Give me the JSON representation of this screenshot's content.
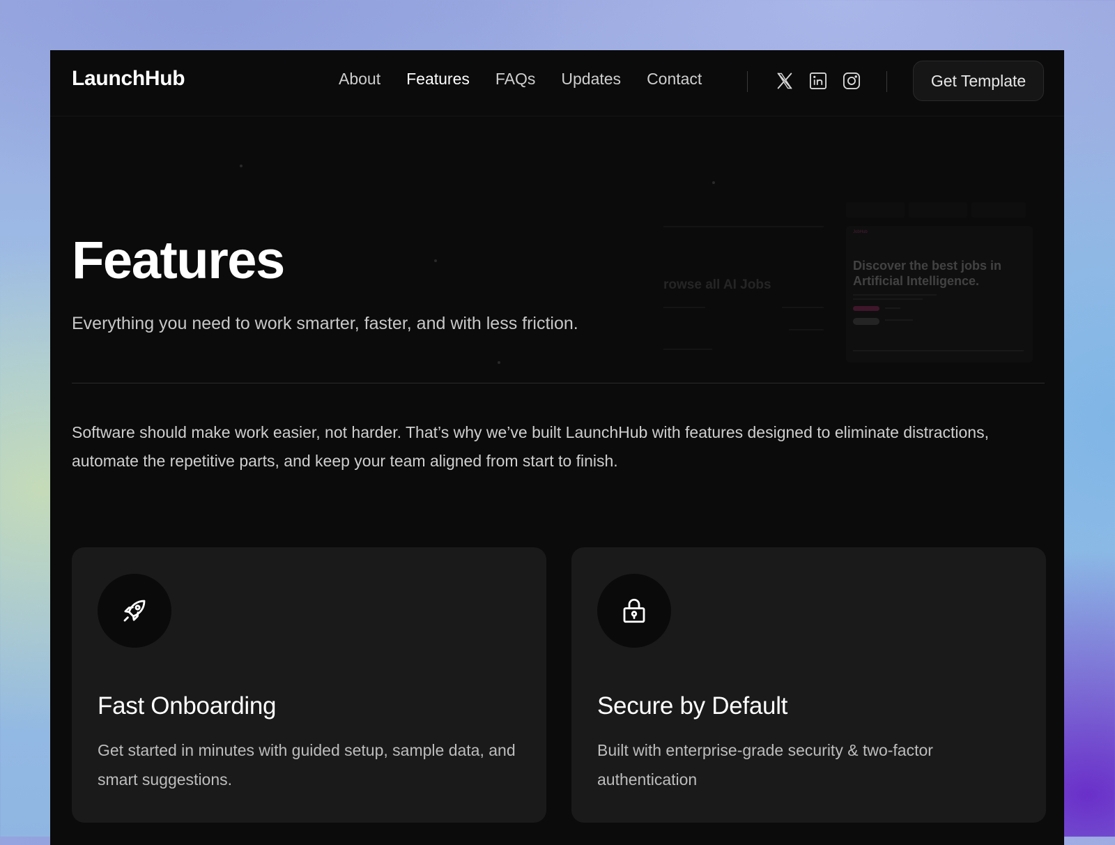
{
  "nav": {
    "logo": "LaunchHub",
    "links": [
      {
        "label": "About",
        "active": false
      },
      {
        "label": "Features",
        "active": true
      },
      {
        "label": "FAQs",
        "active": false
      },
      {
        "label": "Updates",
        "active": false
      },
      {
        "label": "Contact",
        "active": false
      }
    ],
    "social_icons": [
      "x-icon",
      "linkedin-icon",
      "instagram-icon"
    ],
    "cta_label": "Get Template"
  },
  "hero": {
    "title": "Features",
    "subtitle": "Everything you need to work smarter, faster, and with less friction."
  },
  "preview": {
    "left_title": "rowse all AI Jobs",
    "card_brand": "JobHub",
    "card_heading": "Discover the best jobs in Artificial Intelligence."
  },
  "intro": "Software should make work easier, not harder. That’s why we’ve built LaunchHub with features designed to eliminate distractions, automate the repetitive parts, and keep your team aligned from start to finish.",
  "features": [
    {
      "icon": "rocket-icon",
      "title": "Fast Onboarding",
      "description": "Get started in minutes with guided setup, sample data, and smart suggestions."
    },
    {
      "icon": "lock-icon",
      "title": "Secure by Default",
      "description": "Built with enterprise-grade security & two-factor authentication"
    }
  ],
  "colors": {
    "page_bg": "#0b0b0b",
    "card_bg": "#1a1a1a",
    "text_primary": "#ffffff",
    "text_secondary": "#c8c8c8",
    "accent_pill": "#6b2144"
  }
}
